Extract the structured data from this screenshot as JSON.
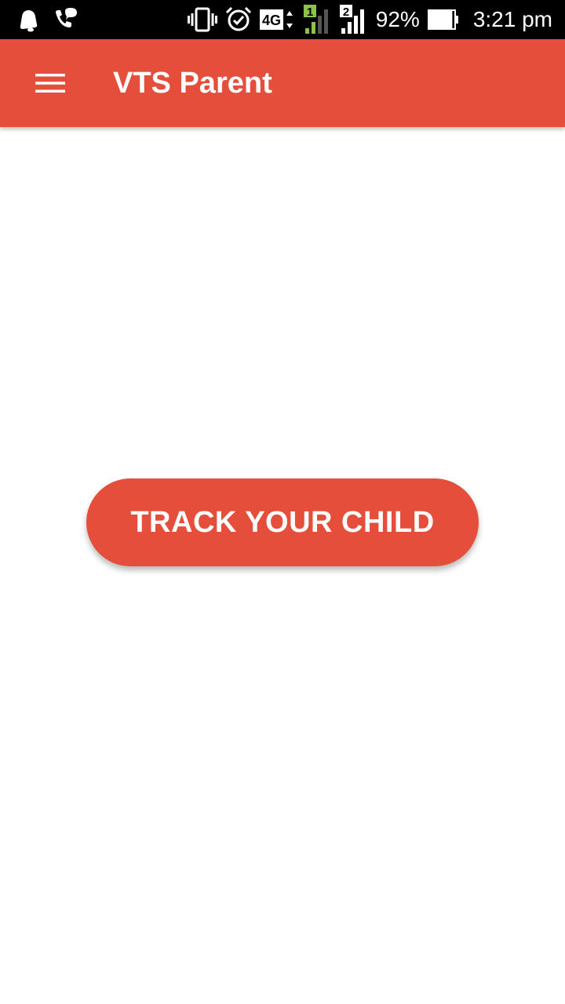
{
  "status_bar": {
    "left_icons": [
      "notification-bell-icon",
      "missed-call-icon"
    ],
    "right_icons": [
      "vibrate-icon",
      "alarm-icon",
      "network-4g-icon",
      "signal-sim1-icon",
      "signal-sim2-icon",
      "battery-icon"
    ],
    "network_type": "4G",
    "sim1_label": "1",
    "sim2_label": "2",
    "battery_percent": "92%",
    "battery_level": 0.92,
    "time": "3:21 pm"
  },
  "app_bar": {
    "title": "VTS Parent",
    "menu_icon": "hamburger-menu-icon"
  },
  "main": {
    "track_button_label": "TRACK YOUR CHILD"
  },
  "colors": {
    "primary": "#E64E3C",
    "status_bar": "#000000",
    "background": "#FFFFFF",
    "signal_active_green": "#8BC34A"
  }
}
